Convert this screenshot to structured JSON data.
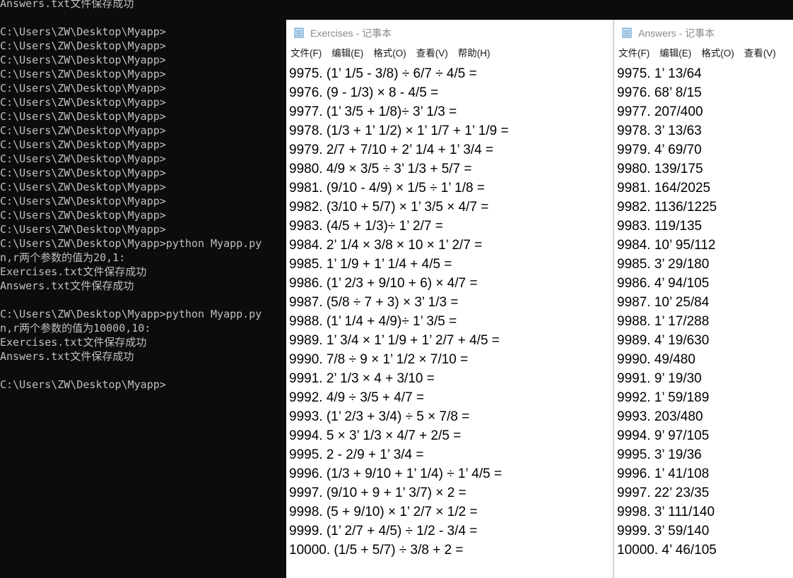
{
  "console": {
    "lines": [
      "Answers.txt文件保存成功",
      "",
      "C:\\Users\\ZW\\Desktop\\Myapp>",
      "C:\\Users\\ZW\\Desktop\\Myapp>",
      "C:\\Users\\ZW\\Desktop\\Myapp>",
      "C:\\Users\\ZW\\Desktop\\Myapp>",
      "C:\\Users\\ZW\\Desktop\\Myapp>",
      "C:\\Users\\ZW\\Desktop\\Myapp>",
      "C:\\Users\\ZW\\Desktop\\Myapp>",
      "C:\\Users\\ZW\\Desktop\\Myapp>",
      "C:\\Users\\ZW\\Desktop\\Myapp>",
      "C:\\Users\\ZW\\Desktop\\Myapp>",
      "C:\\Users\\ZW\\Desktop\\Myapp>",
      "C:\\Users\\ZW\\Desktop\\Myapp>",
      "C:\\Users\\ZW\\Desktop\\Myapp>",
      "C:\\Users\\ZW\\Desktop\\Myapp>",
      "C:\\Users\\ZW\\Desktop\\Myapp>",
      "C:\\Users\\ZW\\Desktop\\Myapp>python Myapp.py",
      "n,r两个参数的值为20,1:",
      "Exercises.txt文件保存成功",
      "Answers.txt文件保存成功",
      "",
      "C:\\Users\\ZW\\Desktop\\Myapp>python Myapp.py",
      "n,r两个参数的值为10000,10:",
      "Exercises.txt文件保存成功",
      "Answers.txt文件保存成功",
      "",
      "C:\\Users\\ZW\\Desktop\\Myapp>"
    ]
  },
  "exercises_window": {
    "title": "Exercises - 记事本",
    "menu": [
      "文件(F)",
      "编辑(E)",
      "格式(O)",
      "查看(V)",
      "帮助(H)"
    ],
    "lines": [
      "9975. (1’ 1/5 - 3/8) ÷ 6/7 ÷ 4/5 =",
      "9976. (9 - 1/3) × 8 - 4/5 =",
      "9977. (1’ 3/5 + 1/8)÷ 3’ 1/3 =",
      "9978. (1/3 + 1’ 1/2) × 1’ 1/7 + 1’ 1/9 =",
      "9979. 2/7 + 7/10 + 2’ 1/4 + 1’ 3/4 =",
      "9980. 4/9 × 3/5 ÷ 3’ 1/3 + 5/7 =",
      "9981. (9/10 - 4/9) × 1/5 ÷ 1’ 1/8 =",
      "9982. (3/10 + 5/7) × 1’ 3/5 × 4/7 =",
      "9983. (4/5 + 1/3)÷ 1’ 2/7 =",
      "9984. 2’ 1/4 × 3/8 × 10 × 1’ 2/7 =",
      "9985. 1’ 1/9 + 1’ 1/4 + 4/5 =",
      "9986. (1’ 2/3 + 9/10 + 6) × 4/7 =",
      "9987. (5/8 ÷ 7 + 3) × 3’ 1/3 =",
      "9988. (1’ 1/4 + 4/9)÷ 1’ 3/5 =",
      "9989. 1’ 3/4 × 1’ 1/9 + 1’ 2/7 + 4/5 =",
      "9990. 7/8 ÷ 9 × 1’ 1/2 × 7/10 =",
      "9991. 2’ 1/3 × 4 + 3/10 =",
      "9992. 4/9 ÷ 3/5 + 4/7 =",
      "9993. (1’ 2/3 + 3/4) ÷ 5 × 7/8 =",
      "9994. 5 × 3’ 1/3 × 4/7 + 2/5 =",
      "9995. 2 - 2/9 + 1’ 3/4 =",
      "9996. (1/3 + 9/10 + 1’ 1/4) ÷ 1’ 4/5 =",
      "9997. (9/10 + 9 + 1’ 3/7) × 2 =",
      "9998. (5 + 9/10) × 1’ 2/7 × 1/2 =",
      "9999. (1’ 2/7 + 4/5) ÷ 1/2 - 3/4 =",
      "10000. (1/5 + 5/7) ÷ 3/8 + 2 ="
    ]
  },
  "answers_window": {
    "title": "Answers - 记事本",
    "menu": [
      "文件(F)",
      "编辑(E)",
      "格式(O)",
      "查看(V)"
    ],
    "lines": [
      "9975. 1’ 13/64",
      "9976. 68’ 8/15",
      "9977. 207/400",
      "9978. 3’ 13/63",
      "9979. 4’ 69/70",
      "9980. 139/175",
      "9981. 164/2025",
      "9982. 1136/1225",
      "9983. 119/135",
      "9984. 10’ 95/112",
      "9985. 3’ 29/180",
      "9986. 4’ 94/105",
      "9987. 10’ 25/84",
      "9988. 1’ 17/288",
      "9989. 4’ 19/630",
      "9990. 49/480",
      "9991. 9’ 19/30",
      "9992. 1’ 59/189",
      "9993. 203/480",
      "9994. 9’ 97/105",
      "9995. 3’ 19/36",
      "9996. 1’ 41/108",
      "9997. 22’ 23/35",
      "9998. 3’ 111/140",
      "9999. 3’ 59/140",
      "10000. 4’ 46/105"
    ]
  }
}
